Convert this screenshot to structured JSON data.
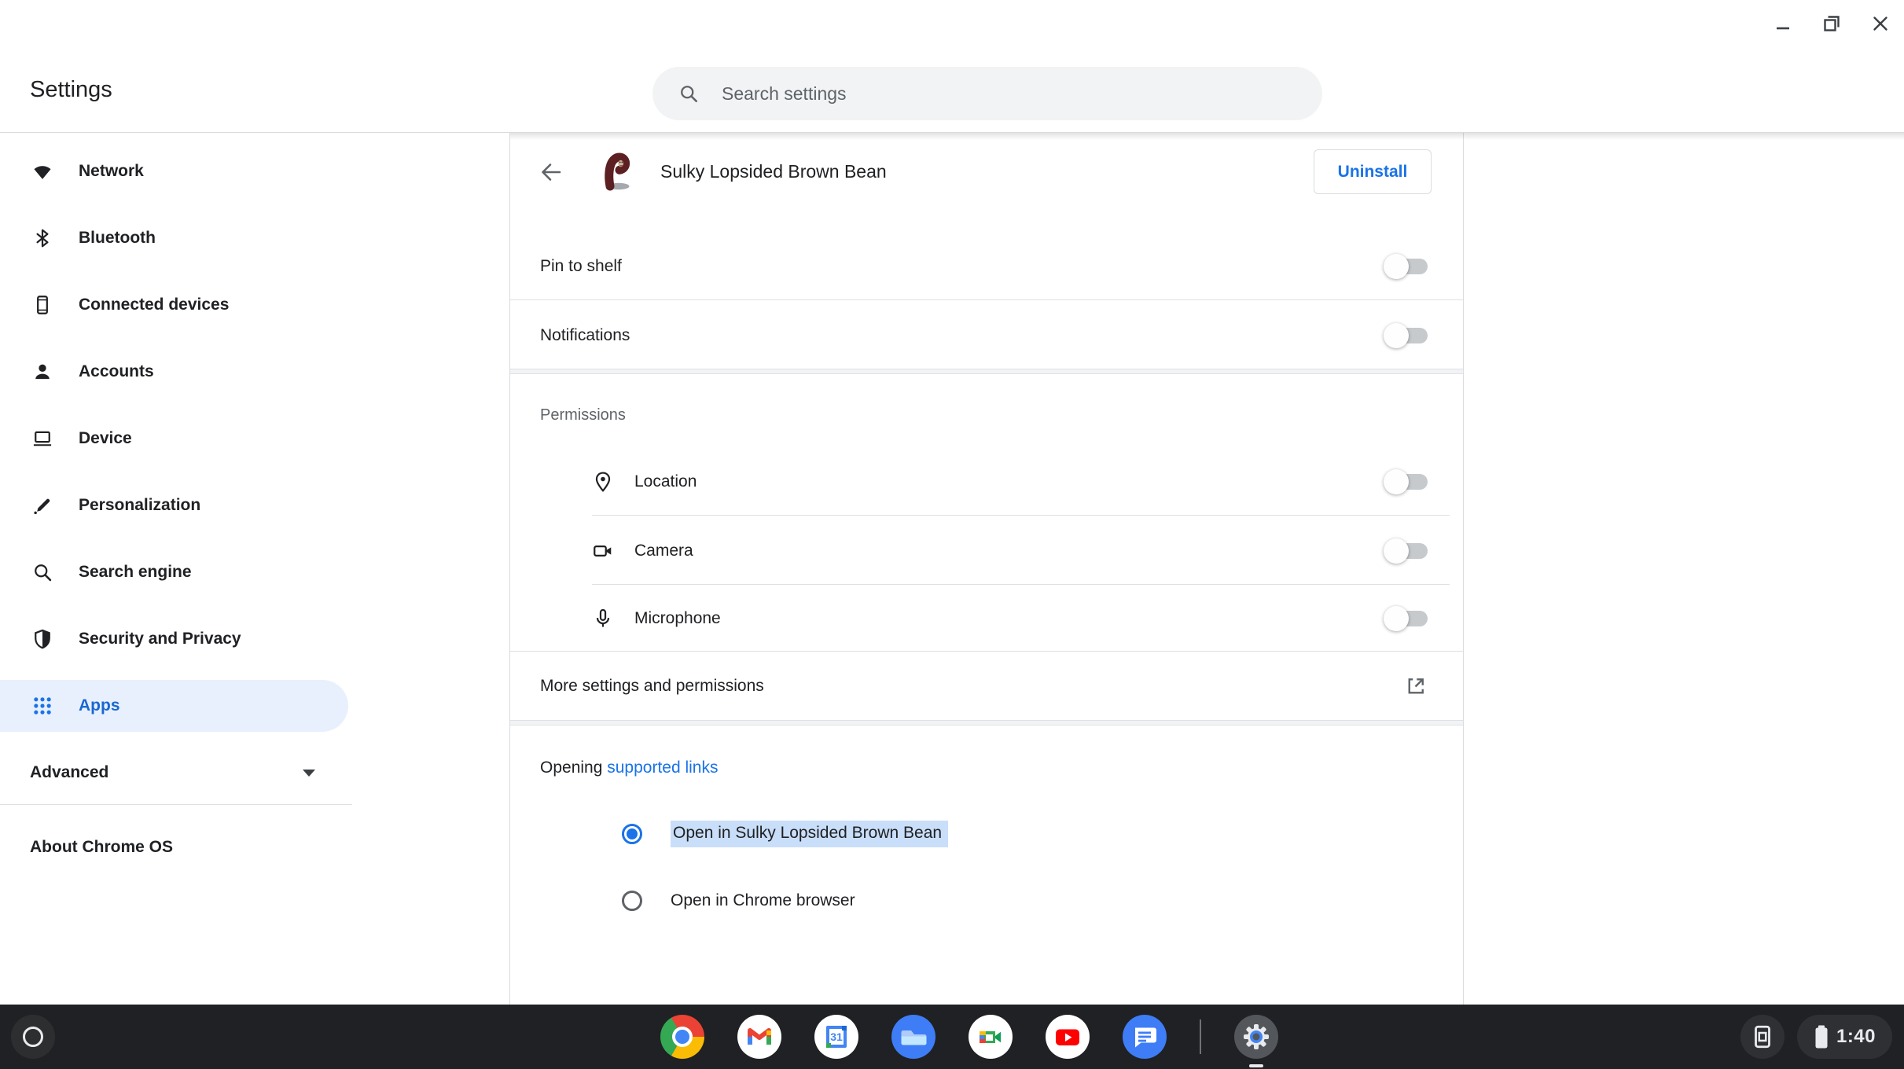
{
  "header": {
    "app_title": "Settings",
    "search_placeholder": "Search settings"
  },
  "window_controls": {
    "minimize_icon": "minimize-icon",
    "restore_icon": "restore-icon",
    "close_icon": "close-icon"
  },
  "sidebar": {
    "items": [
      {
        "label": "Network",
        "icon": "wifi-icon"
      },
      {
        "label": "Bluetooth",
        "icon": "bluetooth-icon"
      },
      {
        "label": "Connected devices",
        "icon": "phone-icon"
      },
      {
        "label": "Accounts",
        "icon": "person-icon"
      },
      {
        "label": "Device",
        "icon": "laptop-icon"
      },
      {
        "label": "Personalization",
        "icon": "brush-icon"
      },
      {
        "label": "Search engine",
        "icon": "search-icon"
      },
      {
        "label": "Security and Privacy",
        "icon": "shield-icon"
      },
      {
        "label": "Apps",
        "icon": "apps-grid-icon",
        "selected": true
      }
    ],
    "advanced_label": "Advanced",
    "about_label": "About Chrome OS"
  },
  "app_page": {
    "back_icon": "back-arrow-icon",
    "app_icon": "bean-app-logo",
    "title": "Sulky Lopsided Brown Bean",
    "uninstall_label": "Uninstall",
    "rows": [
      {
        "label": "Pin to shelf",
        "control": "toggle",
        "state": "off"
      },
      {
        "label": "Notifications",
        "control": "toggle",
        "state": "off"
      }
    ],
    "permissions": {
      "heading": "Permissions",
      "items": [
        {
          "label": "Location",
          "icon": "location-pin-icon",
          "state": "off"
        },
        {
          "label": "Camera",
          "icon": "video-camera-icon",
          "state": "off"
        },
        {
          "label": "Microphone",
          "icon": "microphone-icon",
          "state": "off"
        }
      ]
    },
    "more_settings_label": "More settings and permissions",
    "more_settings_icon": "external-link-icon",
    "opening": {
      "prefix": "Opening ",
      "link_label": "supported links",
      "options": [
        {
          "label": "Open in Sulky Lopsided Brown Bean",
          "selected": true,
          "highlighted": true
        },
        {
          "label": "Open in Chrome browser",
          "selected": false
        }
      ]
    }
  },
  "shelf": {
    "launcher_icon": "launcher-icon",
    "app_icons": [
      "chrome-icon",
      "gmail-icon",
      "calendar-icon",
      "files-icon",
      "meet-icon",
      "youtube-icon",
      "messages-icon",
      "settings-gear-icon"
    ],
    "calendar_day": "31",
    "active_app": "settings",
    "status": {
      "phone_hub_icon": "phone-hub-icon",
      "battery_icon": "battery-icon",
      "time": "1:40"
    }
  },
  "colors": {
    "accent_blue": "#1a73e8",
    "sidebar_selected_bg": "#e8f0fe",
    "sidebar_selected_text": "#1967d2",
    "text_primary": "#202124",
    "text_secondary": "#5f6368",
    "divider": "#e0e0e0",
    "search_bg": "#f1f3f4",
    "selection_highlight": "#c9def8",
    "shelf_bg": "#202124",
    "toggle_off_track": "#c6cacd"
  }
}
